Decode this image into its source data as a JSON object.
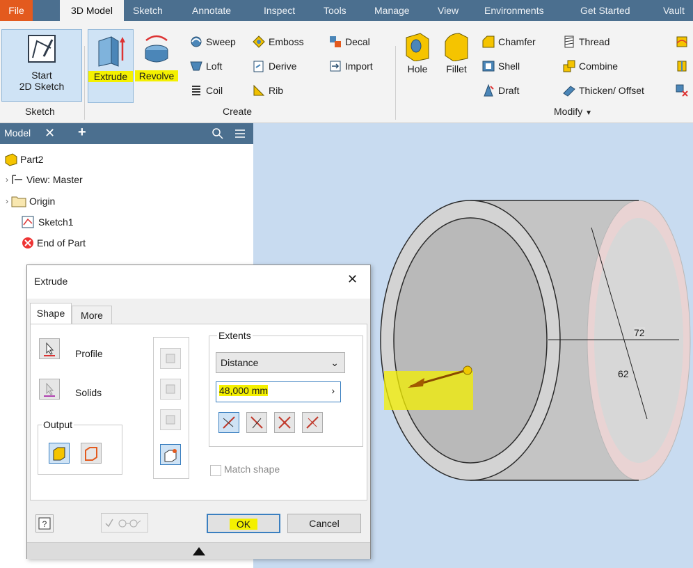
{
  "tabs": [
    "File",
    "3D Model",
    "Sketch",
    "Annotate",
    "Inspect",
    "Tools",
    "Manage",
    "View",
    "Environments",
    "Get Started",
    "Vault"
  ],
  "ribbon": {
    "sketch_panel": {
      "start_line1": "Start",
      "start_line2": "2D Sketch",
      "label": "Sketch"
    },
    "create_panel": {
      "extrude": "Extrude",
      "revolve": "Revolve",
      "sweep": "Sweep",
      "loft": "Loft",
      "coil": "Coil",
      "emboss": "Emboss",
      "derive": "Derive",
      "rib": "Rib",
      "decal": "Decal",
      "import": "Import",
      "label": "Create"
    },
    "modify_panel": {
      "hole": "Hole",
      "fillet": "Fillet",
      "chamfer": "Chamfer",
      "shell": "Shell",
      "draft": "Draft",
      "thread": "Thread",
      "combine": "Combine",
      "thicken": "Thicken/ Offset",
      "label": "Modify"
    }
  },
  "browser": {
    "tab_label": "Model",
    "items": [
      "Part2",
      "View: Master",
      "Origin",
      "Sketch1",
      "End of Part"
    ]
  },
  "viewport": {
    "dim_outer": "72",
    "dim_inner": "62"
  },
  "dialog": {
    "title": "Extrude",
    "tabs": [
      "Shape",
      "More"
    ],
    "profile": "Profile",
    "solids": "Solids",
    "output": "Output",
    "extents": "Extents",
    "extents_type": "Distance",
    "distance": "48,000 mm",
    "match_shape": "Match shape",
    "ok": "OK",
    "cancel": "Cancel"
  },
  "colors": {
    "tab_bar": "#4b6f8f",
    "file_tab": "#e35a1e",
    "viewport": "#c8dbf0",
    "highlight": "#f4f000"
  }
}
